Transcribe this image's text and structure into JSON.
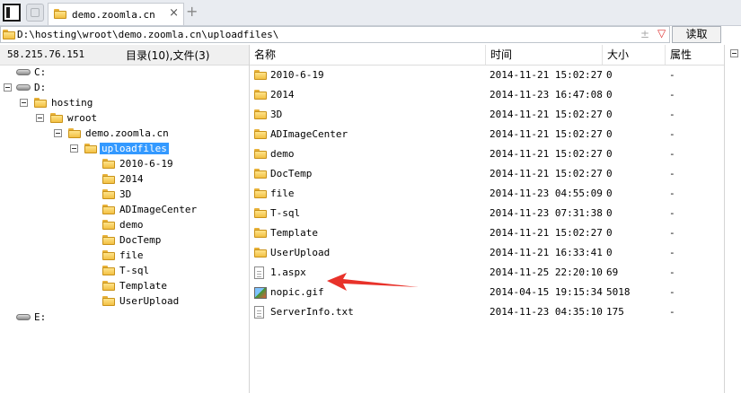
{
  "tab": {
    "title": "demo.zoomla.cn",
    "close": "×",
    "new": "+"
  },
  "address": {
    "path": "D:\\hosting\\wroot\\demo.zoomla.cn\\uploadfiles\\",
    "pm": "±",
    "drop": "▽",
    "read_label": "读取"
  },
  "info": {
    "server_ip": "58.215.76.151",
    "summary": "目录(10),文件(3)"
  },
  "tree": {
    "drive_c": "C:",
    "drive_d": "D:",
    "hosting": "hosting",
    "wroot": "wroot",
    "site": "demo.zoomla.cn",
    "selected": "uploadfiles",
    "children": [
      "2010-6-19",
      "2014",
      "3D",
      "ADImageCenter",
      "demo",
      "DocTemp",
      "file",
      "T-sql",
      "Template",
      "UserUpload"
    ],
    "drive_e": "E:"
  },
  "columns": {
    "name": "名称",
    "time": "时间",
    "size": "大小",
    "attr": "属性"
  },
  "files": [
    {
      "name": "2010-6-19",
      "time": "2014-11-21 15:02:27",
      "size": "0",
      "attr": "-",
      "icon": "folder-icon"
    },
    {
      "name": "2014",
      "time": "2014-11-23 16:47:08",
      "size": "0",
      "attr": "-",
      "icon": "folder-icon"
    },
    {
      "name": "3D",
      "time": "2014-11-21 15:02:27",
      "size": "0",
      "attr": "-",
      "icon": "folder-icon"
    },
    {
      "name": "ADImageCenter",
      "time": "2014-11-21 15:02:27",
      "size": "0",
      "attr": "-",
      "icon": "folder-icon"
    },
    {
      "name": "demo",
      "time": "2014-11-21 15:02:27",
      "size": "0",
      "attr": "-",
      "icon": "folder-icon"
    },
    {
      "name": "DocTemp",
      "time": "2014-11-21 15:02:27",
      "size": "0",
      "attr": "-",
      "icon": "folder-icon"
    },
    {
      "name": "file",
      "time": "2014-11-23 04:55:09",
      "size": "0",
      "attr": "-",
      "icon": "folder-icon"
    },
    {
      "name": "T-sql",
      "time": "2014-11-23 07:31:38",
      "size": "0",
      "attr": "-",
      "icon": "folder-icon"
    },
    {
      "name": "Template",
      "time": "2014-11-21 15:02:27",
      "size": "0",
      "attr": "-",
      "icon": "folder-icon"
    },
    {
      "name": "UserUpload",
      "time": "2014-11-21 16:33:41",
      "size": "0",
      "attr": "-",
      "icon": "folder-icon"
    },
    {
      "name": "1.aspx",
      "time": "2014-11-25 22:20:10",
      "size": "69",
      "attr": "-",
      "icon": "file-icon"
    },
    {
      "name": "nopic.gif",
      "time": "2014-04-15 19:15:34",
      "size": "5018",
      "attr": "-",
      "icon": "image-icon"
    },
    {
      "name": "ServerInfo.txt",
      "time": "2014-11-23 04:35:10",
      "size": "175",
      "attr": "-",
      "icon": "file-icon"
    }
  ],
  "colors": {
    "selection": "#3399ff",
    "folder": "#f2c044",
    "arrow": "#e8322a"
  }
}
